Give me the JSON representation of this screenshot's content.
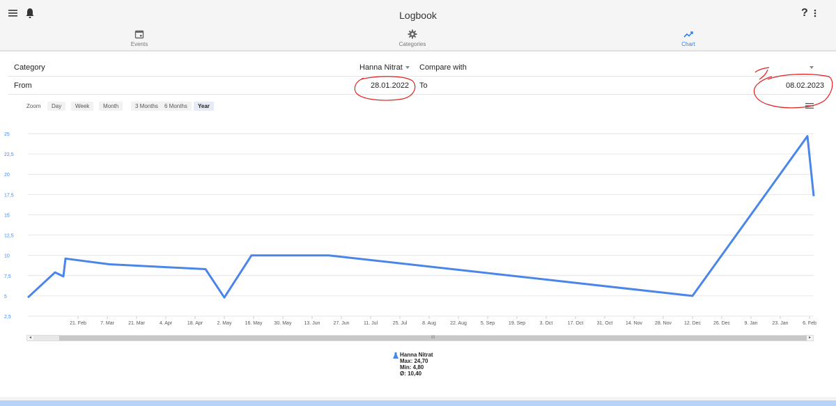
{
  "appbar": {
    "title": "Logbook",
    "left_icons": [
      "menu-icon",
      "bell-icon"
    ],
    "right_icons": [
      "help-icon",
      "more-vertical-icon"
    ],
    "help_glyph": "?"
  },
  "tabs": [
    {
      "label": "Events",
      "icon": "calendar-icon",
      "active": false
    },
    {
      "label": "Categories",
      "icon": "gear-icon",
      "active": false
    },
    {
      "label": "Chart",
      "icon": "trending-up-icon",
      "active": true
    }
  ],
  "form": {
    "category_label": "Category",
    "category_value": "Hanna Nitrat",
    "compare_label": "Compare with",
    "from_label": "From",
    "from_value": "28.01.2022",
    "to_label": "To",
    "to_value": "08.02.2023"
  },
  "zoom": {
    "label": "Zoom",
    "options": [
      "Day",
      "Week",
      "Month",
      "3 Months",
      "6 Months",
      "Year"
    ],
    "selected": "Year"
  },
  "colors": {
    "series": "#4a86e8",
    "accent": "#2f80ed",
    "annotation": "#e02020"
  },
  "chart_data": {
    "type": "line",
    "title": "",
    "xlabel": "",
    "ylabel": "",
    "ylim": [
      2.5,
      25
    ],
    "yticks": [
      "2,5",
      "5",
      "7,5",
      "10",
      "12,5",
      "15",
      "17,5",
      "20",
      "22,5",
      "25"
    ],
    "xtick_labels": [
      "21. Feb",
      "7. Mar",
      "21. Mar",
      "4. Apr",
      "18. Apr",
      "2. May",
      "16. May",
      "30. May",
      "13. Jun",
      "27. Jun",
      "11. Jul",
      "25. Jul",
      "8. Aug",
      "22. Aug",
      "5. Sep",
      "19. Sep",
      "3. Oct",
      "17. Oct",
      "31. Oct",
      "14. Nov",
      "28. Nov",
      "12. Dec",
      "26. Dec",
      "9. Jan",
      "23. Jan",
      "6. Feb"
    ],
    "grid": true,
    "legend_placement": "bottom-center",
    "series": [
      {
        "name": "Hanna Nitrat",
        "points": [
          {
            "x": "2022-01-28",
            "y": 4.8
          },
          {
            "x": "2022-02-10",
            "y": 7.9
          },
          {
            "x": "2022-02-14",
            "y": 7.4
          },
          {
            "x": "2022-02-15",
            "y": 9.6
          },
          {
            "x": "2022-03-08",
            "y": 8.9
          },
          {
            "x": "2022-04-23",
            "y": 8.3
          },
          {
            "x": "2022-05-02",
            "y": 4.8
          },
          {
            "x": "2022-05-15",
            "y": 10.0
          },
          {
            "x": "2022-06-21",
            "y": 10.0
          },
          {
            "x": "2022-12-12",
            "y": 5.0
          },
          {
            "x": "2023-02-05",
            "y": 24.7
          },
          {
            "x": "2023-02-08",
            "y": 17.3
          }
        ]
      }
    ]
  },
  "legend": {
    "icon": "flask-icon",
    "name": "Hanna Nitrat",
    "max": "Max: 24,70",
    "min": "Min: 4,80",
    "avg": "Ø: 10,40"
  },
  "scrollbar": {
    "grip": "III",
    "left_arrow": "◂",
    "right_arrow": "▸"
  }
}
